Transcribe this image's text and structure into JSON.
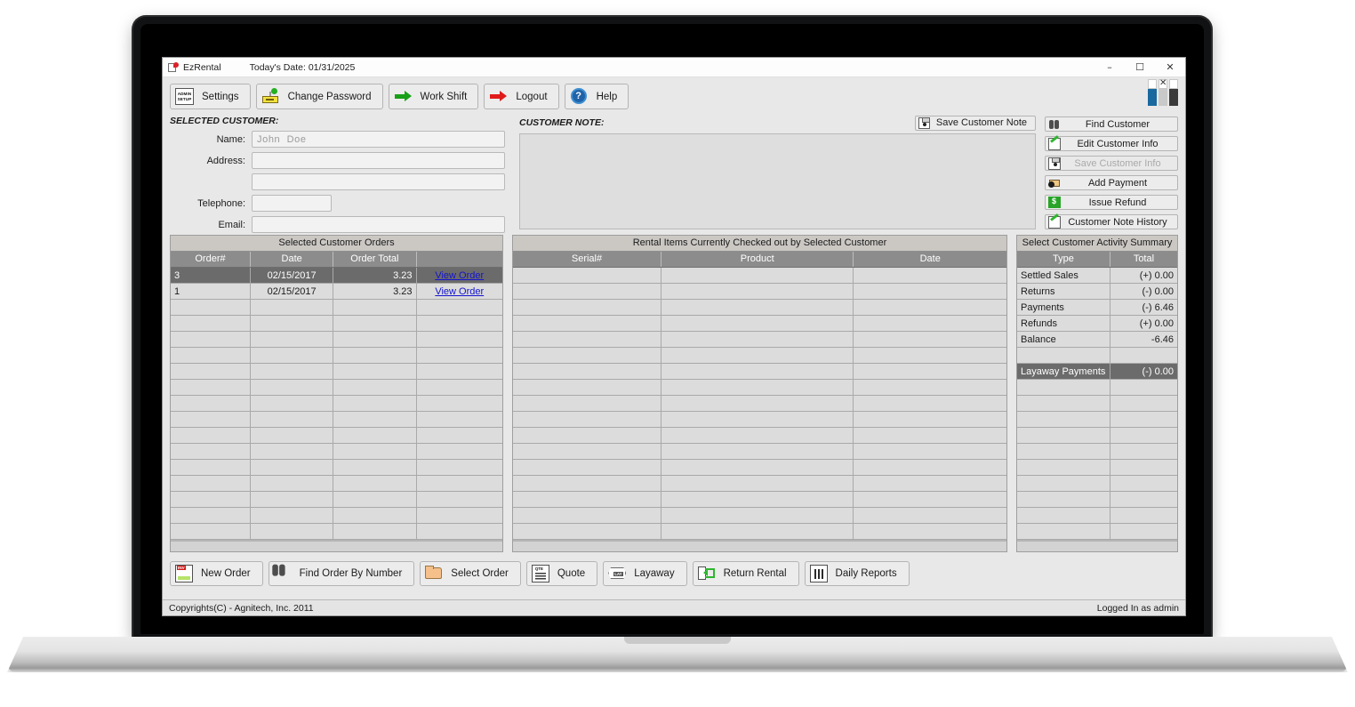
{
  "window": {
    "app_title": "EzRental",
    "today_date": "Today's Date: 01/31/2025",
    "minimize": "–",
    "maximize": "☐",
    "close": "✕"
  },
  "toolbar": {
    "buttons": [
      {
        "label": "Settings",
        "icon": "admin-setup-icon",
        "icon_text_1": "ADMIN",
        "icon_text_2": "SETUP"
      },
      {
        "label": "Change Password",
        "icon": "password-card-icon"
      },
      {
        "label": "Work Shift",
        "icon": "green-arrow-icon"
      },
      {
        "label": "Logout",
        "icon": "red-arrow-icon"
      },
      {
        "label": "Help",
        "icon": "help-circle-icon",
        "glyph": "?"
      }
    ]
  },
  "customer": {
    "section_label": "SELECTED CUSTOMER:",
    "fields": [
      {
        "label": "Name:",
        "value": "",
        "placeholder": "John  Doe"
      },
      {
        "label": "Address:",
        "value": "",
        "placeholder": ""
      },
      {
        "label": "",
        "value": "",
        "placeholder": ""
      },
      {
        "label": "Telephone:",
        "value": "",
        "placeholder": ""
      },
      {
        "label": "Email:",
        "value": "",
        "placeholder": ""
      }
    ]
  },
  "note": {
    "section_label": "CUSTOMER NOTE:",
    "save_label": "Save Customer Note",
    "value": "",
    "placeholder": ""
  },
  "right_buttons": [
    {
      "label": "Find Customer",
      "icon": "binoculars-icon",
      "disabled": false
    },
    {
      "label": "Edit Customer Info",
      "icon": "pencil-icon",
      "disabled": false
    },
    {
      "label": "Save Customer Info",
      "icon": "save-disk-icon",
      "disabled": true
    },
    {
      "label": "Add Payment",
      "icon": "wallet-icon",
      "disabled": false
    },
    {
      "label": "Issue Refund",
      "icon": "refund-icon",
      "disabled": false
    },
    {
      "label": "Customer Note History",
      "icon": "pencil-icon",
      "disabled": false
    }
  ],
  "grid_orders": {
    "title": "Selected Customer Orders",
    "columns": [
      "Order#",
      "Date",
      "Order Total",
      ""
    ],
    "rows": [
      {
        "order": "3",
        "date": "02/15/2017",
        "total": "3.23",
        "action": "View Order",
        "selected": true
      },
      {
        "order": "1",
        "date": "02/15/2017",
        "total": "3.23",
        "action": "View Order",
        "selected": false
      }
    ],
    "empty_rows": 15
  },
  "grid_rentals": {
    "title": "Rental Items Currently Checked out by Selected Customer",
    "columns": [
      "Serial#",
      "Product",
      "Date"
    ],
    "rows": [],
    "empty_rows": 17
  },
  "grid_summary": {
    "title": "Select Customer Activity Summary",
    "columns": [
      "Type",
      "Total"
    ],
    "rows": [
      {
        "type": "Settled Sales",
        "total": "(+) 0.00",
        "selected": false
      },
      {
        "type": "Returns",
        "total": "(-) 0.00",
        "selected": false
      },
      {
        "type": "Payments",
        "total": "(-) 6.46",
        "selected": false
      },
      {
        "type": "Refunds",
        "total": "(+) 0.00",
        "selected": false
      },
      {
        "type": "Balance",
        "total": "-6.46",
        "selected": false
      },
      {
        "type": "",
        "total": "",
        "selected": false
      },
      {
        "type": "Layaway Payments",
        "total": "(-) 0.00",
        "selected": true
      }
    ],
    "empty_rows": 10
  },
  "bottom_buttons": [
    {
      "label": "New Order",
      "icon": "invoice-icon"
    },
    {
      "label": "Find Order By Number",
      "icon": "binoculars-icon"
    },
    {
      "label": "Select Order",
      "icon": "folder-icon"
    },
    {
      "label": "Quote",
      "icon": "quote-doc-icon"
    },
    {
      "label": "Layaway",
      "icon": "layaway-badge-icon"
    },
    {
      "label": "Return Rental",
      "icon": "return-arrow-icon"
    },
    {
      "label": "Daily Reports",
      "icon": "report-chart-icon"
    }
  ],
  "statusbar": {
    "left": "Copyrights(C) - Agnitech, Inc. 2011",
    "right": "Logged In as admin"
  }
}
